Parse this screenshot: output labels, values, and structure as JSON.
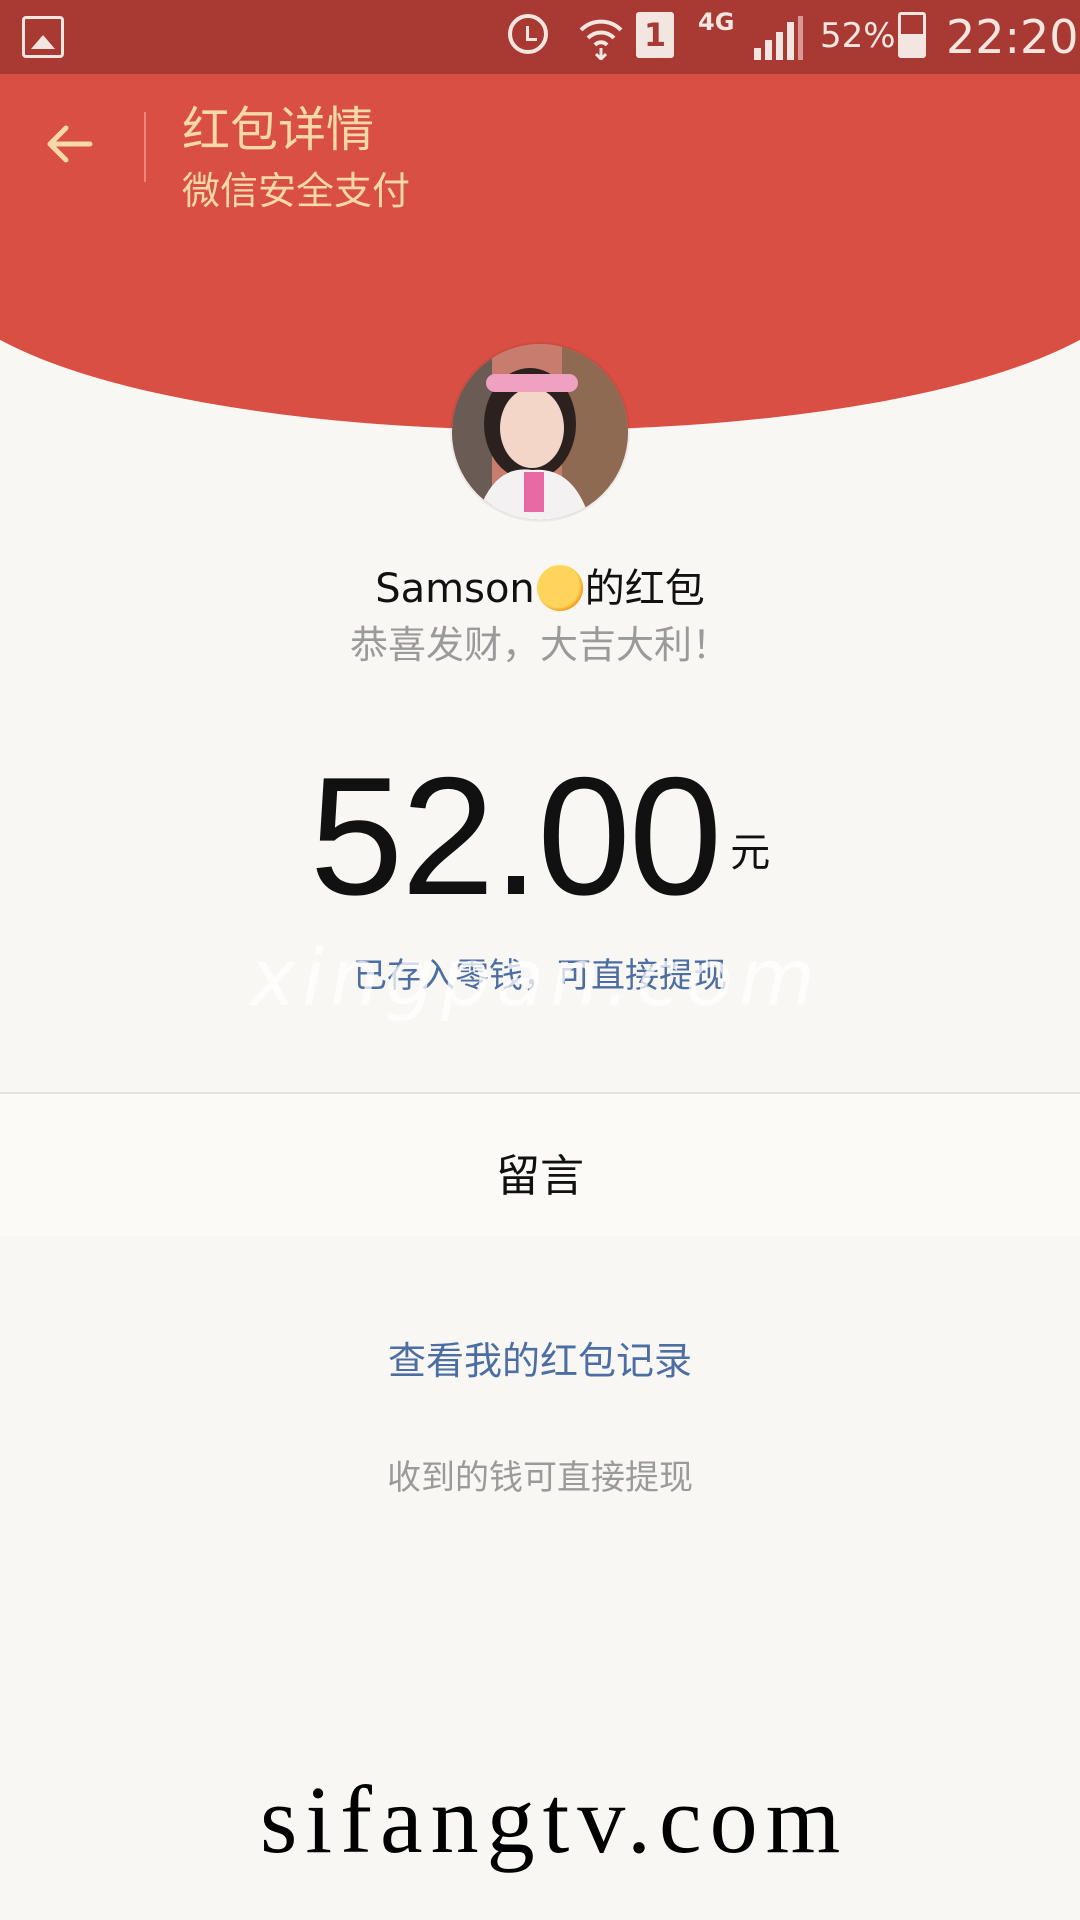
{
  "status_bar": {
    "icons": [
      "gallery-icon",
      "alarm-icon",
      "wifi-icon",
      "sim-1-icon",
      "signal-icon",
      "battery-icon"
    ],
    "sim_label": "1",
    "network": "4G",
    "battery": "52%",
    "time": "22:20"
  },
  "header": {
    "back_icon": "arrow-left-icon",
    "title": "红包详情",
    "subtitle": "微信安全支付"
  },
  "sender": {
    "name": "Samson",
    "emoji": "sun-icon",
    "suffix": "的红包",
    "blessing": "恭喜发财，大吉大利！"
  },
  "amount": {
    "value": "52.00",
    "unit": "元",
    "note": "已存入零钱，可直接提现"
  },
  "message_button": "留言",
  "records_link": "查看我的红包记录",
  "footer_tip": "收到的钱可直接提现",
  "watermarks": {
    "overlay": "xingpan.com",
    "site": "sifangtv.com"
  },
  "colors": {
    "header_red": "#d94f43",
    "status_red": "#a83a33",
    "gold_text": "#f7d9a7",
    "link_blue": "#4c6ea3"
  }
}
